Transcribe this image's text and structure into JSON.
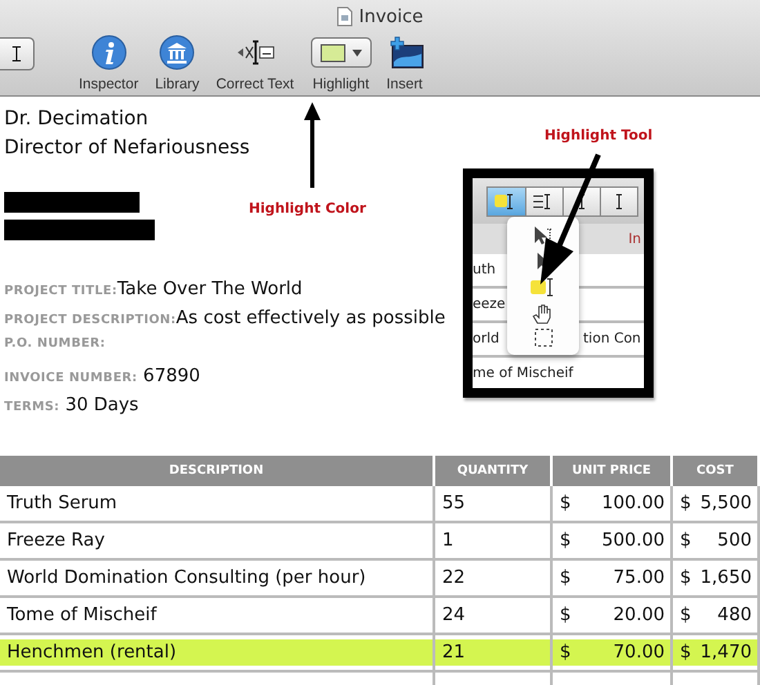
{
  "window": {
    "title": "Invoice"
  },
  "toolbar": [
    {
      "kind": "inspector",
      "label": "Inspector"
    },
    {
      "kind": "library",
      "label": "Library"
    },
    {
      "kind": "correct_text",
      "label": "Correct Text"
    },
    {
      "kind": "highlight",
      "label": "Highlight"
    },
    {
      "kind": "insert",
      "label": "Insert"
    }
  ],
  "recipient": [
    "Dr. Decimation",
    "Director of Nefariousness"
  ],
  "fields": [
    {
      "label": "PROJECT TITLE:",
      "value": "Take Over The World"
    },
    {
      "label": "PROJECT DESCRIPTION:",
      "value": "As cost effectively as possible"
    },
    {
      "label": "P.O. NUMBER:"
    },
    {
      "label": "INVOICE NUMBER:",
      "value": " 67890"
    },
    {
      "label": "TERMS:",
      "value": " 30 Days"
    }
  ],
  "annotations": [
    {
      "kind": "up",
      "text": "Highlight Color"
    },
    {
      "kind": "diagonal",
      "text": "Highlight Tool"
    }
  ],
  "inset": {
    "tool_buttons": [
      {
        "selected": true
      },
      {
        "selected": false
      },
      {
        "selected": false
      },
      {
        "selected": false
      }
    ],
    "header": [
      "In"
    ],
    "rows": [
      [
        "uth"
      ],
      [
        "eeze"
      ],
      [
        "orld",
        "tion Con"
      ],
      [
        "me of Mischeif"
      ]
    ]
  },
  "table": {
    "columns": [
      "DESCRIPTION",
      "QUANTITY",
      "UNIT PRICE",
      "COST"
    ],
    "rows": [
      {
        "description": "Truth Serum",
        "quantity": "55",
        "unit_price": "100.00",
        "cost": "5,500",
        "highlighted": false
      },
      {
        "description": "Freeze Ray",
        "quantity": "1",
        "unit_price": "500.00",
        "cost": "500",
        "highlighted": false
      },
      {
        "description": "World Domination Consulting (per hour)",
        "quantity": "22",
        "unit_price": "75.00",
        "cost": "1,650",
        "highlighted": false
      },
      {
        "description": "Tome of Mischeif",
        "quantity": "24",
        "unit_price": "20.00",
        "cost": "480",
        "highlighted": false
      },
      {
        "description": "Henchmen (rental)",
        "quantity": "21",
        "unit_price": "70.00",
        "cost": "1,470",
        "highlighted": true
      }
    ],
    "currency": "$"
  }
}
